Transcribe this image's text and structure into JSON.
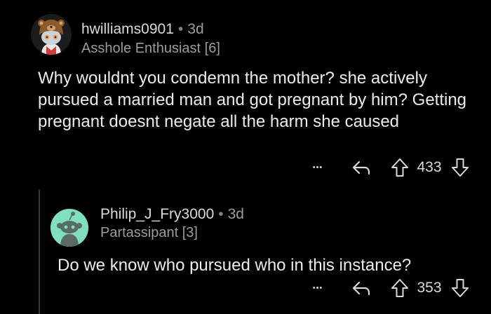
{
  "comments": [
    {
      "username": "hwilliams0901",
      "separator": "•",
      "age": "3d",
      "flair": "Asshole Enthusiast [6]",
      "body": "Why wouldnt you condemn the mother? she actively pursued a married man and got pregnant by him? Getting pregnant doesnt negate all the harm she caused",
      "score": "433",
      "more_label": "•••"
    },
    {
      "username": "Philip_J_Fry3000",
      "separator": "•",
      "age": "3d",
      "flair": "Partassipant [3]",
      "body": "Do we know who pursued who in this instance?",
      "score": "353",
      "more_label": "•••"
    }
  ],
  "icons": {
    "more": "more-dots-icon",
    "reply": "reply-arrow-icon",
    "upvote": "upvote-arrow-icon",
    "downvote": "downvote-arrow-icon",
    "avatar_1": "snoo-avatar-bear-hat",
    "avatar_2": "snoo-avatar-default"
  },
  "colors": {
    "background": "#000000",
    "text": "#ececec",
    "meta": "#9a9c9e",
    "icon": "#d7dadc",
    "avatar_2_bg": "#7fe0c0",
    "thread_line": "#343536"
  }
}
